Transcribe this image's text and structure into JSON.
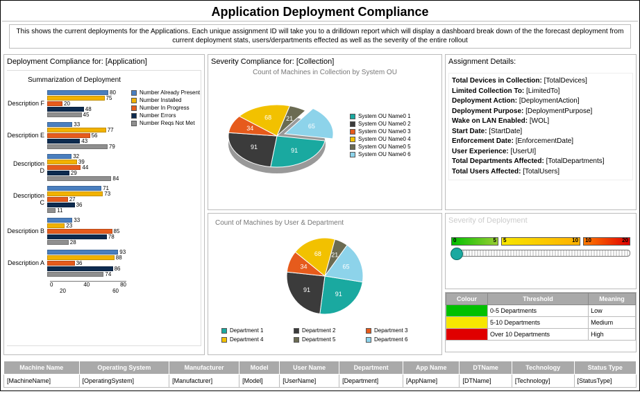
{
  "title": "Application Deployment Compliance",
  "intro": "This shows the current deployments for the Applications. Each unique assignment ID will take you to a drilldown report which will display a dashboard break down of the the forecast deployment from current deployment stats, users/derpartments effected as well as the severity of the entire rollout",
  "panel_titles": {
    "deployment": "Deployment Compliance for: [Application]",
    "severity": "Severity Compliance for: [Collection]",
    "details": "Assignment Details:",
    "sev_deploy": "Severity of Deployment"
  },
  "summarization": {
    "title": "Summarization of Deployment",
    "legend": [
      {
        "label": "Number Already Present",
        "color": "#4a7fbf"
      },
      {
        "label": "Number Installed",
        "color": "#f2b200"
      },
      {
        "label": "Number In Progress",
        "color": "#e65b1c"
      },
      {
        "label": "Number Errors",
        "color": "#0d2b4f"
      },
      {
        "label": "Number Reqs Not Met",
        "color": "#8f8f8f"
      }
    ],
    "categories": [
      "Description F",
      "Description E",
      "Description D",
      "Description C",
      "Description B",
      "Description A"
    ],
    "values": {
      "Description F": [
        80,
        75,
        20,
        48,
        45
      ],
      "Description E": [
        33,
        77,
        56,
        43,
        79
      ],
      "Description D": [
        32,
        39,
        44,
        29,
        84
      ],
      "Description C": [
        71,
        73,
        27,
        36,
        11
      ],
      "Description B": [
        33,
        23,
        85,
        78,
        28
      ],
      "Description A": [
        93,
        88,
        36,
        86,
        74
      ]
    },
    "axis_ticks_top": [
      "0",
      "40",
      "80"
    ],
    "axis_ticks_bot": [
      "20",
      "60"
    ]
  },
  "pie_ou": {
    "title": "Count of Machines in Collection by System OU",
    "slices": [
      {
        "label": "System OU Name0 1",
        "value": 91,
        "color": "#1aa9a0"
      },
      {
        "label": "System OU Name0 2",
        "value": 91,
        "color": "#3b3b3b"
      },
      {
        "label": "System OU Name0 3",
        "value": 34,
        "color": "#e65b1c"
      },
      {
        "label": "System OU Name0 4",
        "value": 68,
        "color": "#f2c100"
      },
      {
        "label": "System OU Name0 5",
        "value": 21,
        "color": "#6b6b52"
      },
      {
        "label": "System OU Name0 6",
        "value": 65,
        "color": "#8dd3ea"
      }
    ]
  },
  "pie_dept": {
    "title": "Count of Machines by User & Department",
    "slices": [
      {
        "label": "Department 1",
        "value": 91,
        "color": "#1aa9a0"
      },
      {
        "label": "Department 2",
        "value": 91,
        "color": "#3b3b3b"
      },
      {
        "label": "Department 3",
        "value": 34,
        "color": "#e65b1c"
      },
      {
        "label": "Department 4",
        "value": 68,
        "color": "#f2c100"
      },
      {
        "label": "Department 5",
        "value": 21,
        "color": "#6b6b52"
      },
      {
        "label": "Department 6",
        "value": 65,
        "color": "#8dd3ea"
      }
    ]
  },
  "details": [
    {
      "k": "Total Devices in Collection:",
      "v": "[TotalDevices]"
    },
    {
      "k": "Limited Collection To:",
      "v": "[LimitedTo]"
    },
    {
      "k": "Deployment Action:",
      "v": "[DeploymentAction]"
    },
    {
      "k": "Deployment Purpose:",
      "v": "[DeploymentPurpose]"
    },
    {
      "k": "Wake on LAN Enabled:",
      "v": "[WOL]"
    },
    {
      "k": "Start Date:",
      "v": "[StartDate]"
    },
    {
      "k": "Enforcement Date:",
      "v": "[EnforcementDate]"
    },
    {
      "k": "User Experience:",
      "v": "[UserUI]"
    },
    {
      "k": "Total Departments Affected:",
      "v": "[TotalDepartments]"
    },
    {
      "k": "Total Users Affected:",
      "v": "[TotalUsers]"
    }
  ],
  "gauge": {
    "left": "0",
    "mid": "5",
    "right": "10",
    "far": "20"
  },
  "threshold_table": {
    "headers": [
      "Colour",
      "Threshold",
      "Meaning"
    ],
    "rows": [
      {
        "color": "#00c000",
        "threshold": "0-5 Departments",
        "meaning": "Low"
      },
      {
        "color": "#f7e600",
        "threshold": "5-10 Departments",
        "meaning": "Medium"
      },
      {
        "color": "#e00000",
        "threshold": "Over 10 Departments",
        "meaning": "High"
      }
    ]
  },
  "machine_table": {
    "headers": [
      "Machine Name",
      "Operating System",
      "Manufacturer",
      "Model",
      "User Name",
      "Department",
      "App Name",
      "DTName",
      "Technology",
      "Status Type"
    ],
    "row": [
      "[MachineName]",
      "[OperatingSystem]",
      "[Manufacturer]",
      "[Model]",
      "[UserName]",
      "[Department]",
      "[AppName]",
      "[DTName]",
      "[Technology]",
      "[StatusType]"
    ]
  },
  "chart_data": [
    {
      "type": "bar",
      "title": "Summarization of Deployment",
      "orientation": "horizontal",
      "categories": [
        "Description F",
        "Description E",
        "Description D",
        "Description C",
        "Description B",
        "Description A"
      ],
      "series": [
        {
          "name": "Number Already Present",
          "values": [
            80,
            33,
            32,
            71,
            33,
            93
          ]
        },
        {
          "name": "Number Installed",
          "values": [
            75,
            77,
            39,
            73,
            23,
            88
          ]
        },
        {
          "name": "Number In Progress",
          "values": [
            20,
            56,
            44,
            27,
            85,
            36
          ]
        },
        {
          "name": "Number Errors",
          "values": [
            48,
            43,
            29,
            36,
            78,
            86
          ]
        },
        {
          "name": "Number Reqs Not Met",
          "values": [
            45,
            79,
            84,
            11,
            28,
            74
          ]
        }
      ],
      "xlim": [
        0,
        100
      ]
    },
    {
      "type": "pie",
      "title": "Count of Machines in Collection by System OU",
      "categories": [
        "System OU Name0 1",
        "System OU Name0 2",
        "System OU Name0 3",
        "System OU Name0 4",
        "System OU Name0 5",
        "System OU Name0 6"
      ],
      "values": [
        91,
        91,
        34,
        68,
        21,
        65
      ]
    },
    {
      "type": "pie",
      "title": "Count of Machines by User & Department",
      "categories": [
        "Department 1",
        "Department 2",
        "Department 3",
        "Department 4",
        "Department 5",
        "Department 6"
      ],
      "values": [
        91,
        91,
        34,
        68,
        21,
        65
      ]
    }
  ]
}
